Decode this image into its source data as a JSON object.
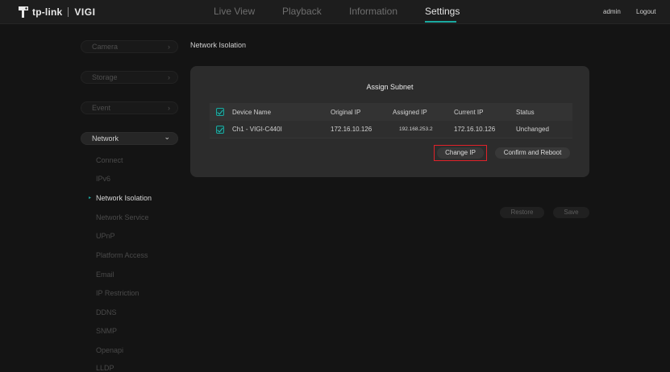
{
  "header": {
    "logo_text": "tp-link",
    "logo_product": "VIGI",
    "tabs": [
      {
        "label": "Live View",
        "active": false
      },
      {
        "label": "Playback",
        "active": false
      },
      {
        "label": "Information",
        "active": false
      },
      {
        "label": "Settings",
        "active": true
      }
    ],
    "user": "admin",
    "logout": "Logout"
  },
  "sidebar": {
    "groups": [
      {
        "label": "Camera",
        "chevron": "›"
      },
      {
        "label": "Storage",
        "chevron": "›"
      },
      {
        "label": "Event",
        "chevron": "›"
      },
      {
        "label": "Network",
        "chevron": "⌄"
      }
    ],
    "network_items": [
      {
        "label": "Connect"
      },
      {
        "label": "IPv6"
      },
      {
        "label": "Network Isolation"
      },
      {
        "label": "Network Service"
      },
      {
        "label": "UPnP"
      },
      {
        "label": "Platform Access"
      },
      {
        "label": "Email"
      },
      {
        "label": "IP Restriction"
      },
      {
        "label": "DDNS"
      },
      {
        "label": "SNMP"
      },
      {
        "label": "Openapi"
      },
      {
        "label": "LLDP"
      }
    ],
    "active_marker": "▸"
  },
  "main": {
    "page_title": "Network Isolation",
    "dialog": {
      "title": "Assign Subnet",
      "columns": [
        "Device Name",
        "Original IP",
        "Assigned IP",
        "Current IP",
        "Status"
      ],
      "rows": [
        {
          "device": "Ch1 - VIGI-C440I",
          "original_ip": "172.16.10.126",
          "assigned_ip": "192.168.253.2",
          "current_ip": "172.16.10.126",
          "status": "Unchanged"
        }
      ],
      "change_ip_label": "Change IP",
      "confirm_label": "Confirm and Reboot"
    },
    "restore_label": "Restore",
    "save_label": "Save"
  },
  "colors": {
    "accent": "#1aa9a0",
    "highlight": "#e0222a",
    "background": "#141414"
  }
}
